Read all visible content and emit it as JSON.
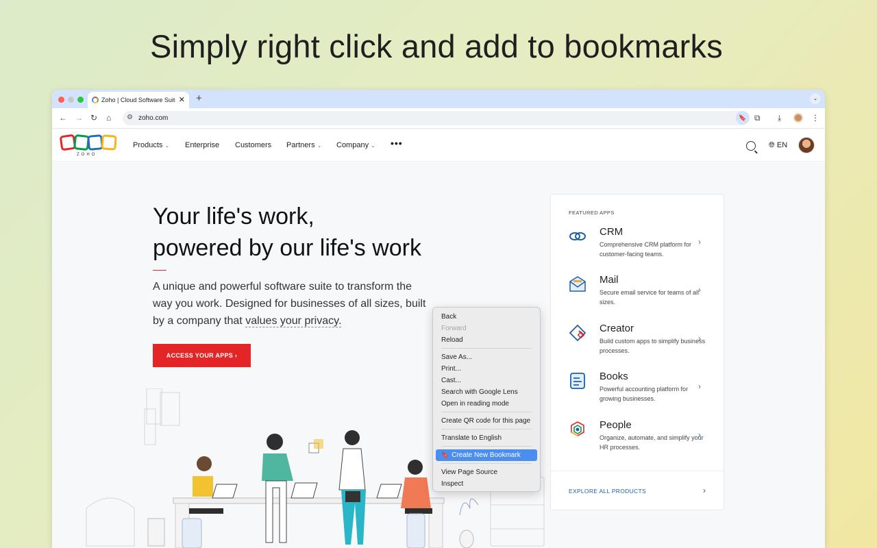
{
  "headline": "Simply right click and add to bookmarks",
  "browser": {
    "tab_title": "Zoho | Cloud Software Suite f",
    "tab_close": "✕",
    "new_tab": "+",
    "url": "zoho.com"
  },
  "site": {
    "logo_word": "ZOHO",
    "nav": {
      "products": "Products",
      "enterprise": "Enterprise",
      "customers": "Customers",
      "partners": "Partners",
      "company": "Company",
      "more": "•••",
      "language": "EN"
    },
    "hero": {
      "title_line1": "Your life's work,",
      "title_line2": "powered by our life's work",
      "desc_part1": "A unique and powerful software suite to transform the way you work. Designed for businesses of all sizes, built by a company that ",
      "desc_link": "values your privacy.",
      "cta": "ACCESS YOUR APPS  ›"
    },
    "featured": {
      "heading": "FEATURED APPS",
      "apps": [
        {
          "name": "CRM",
          "desc": "Comprehensive CRM platform for customer-facing teams.",
          "icon": "crm-icon"
        },
        {
          "name": "Mail",
          "desc": "Secure email service for teams of all sizes.",
          "icon": "mail-icon"
        },
        {
          "name": "Creator",
          "desc": "Build custom apps to simplify business processes.",
          "icon": "creator-icon"
        },
        {
          "name": "Books",
          "desc": "Powerful accounting platform for growing businesses.",
          "icon": "books-icon"
        },
        {
          "name": "People",
          "desc": "Organize, automate, and simplify your HR processes.",
          "icon": "people-icon"
        }
      ],
      "explore": "EXPLORE ALL PRODUCTS"
    }
  },
  "context_menu": {
    "back": "Back",
    "forward": "Forward",
    "reload": "Reload",
    "save_as": "Save As...",
    "print": "Print...",
    "cast": "Cast...",
    "search_lens": "Search with Google Lens",
    "reading_mode": "Open in reading mode",
    "qr_code": "Create QR code for this page",
    "translate": "Translate to English",
    "create_bookmark": "Create New Bookmark",
    "view_source": "View Page Source",
    "inspect": "Inspect"
  },
  "colors": {
    "accent_red": "#e42527",
    "link_blue": "#1f5fa8",
    "menu_highlight": "#4a8ef0"
  }
}
